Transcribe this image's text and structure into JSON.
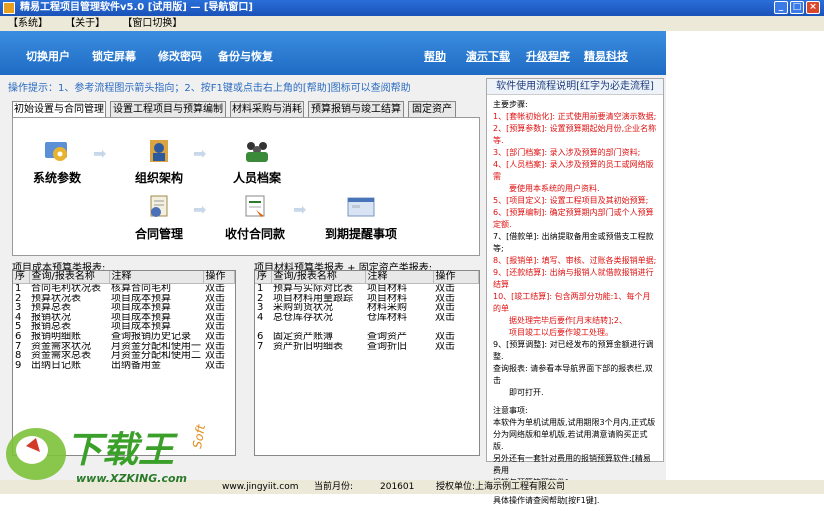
{
  "titlebar": {
    "title": "精易工程项目管理软件v5.0 [试用版] — [导航窗口]"
  },
  "window_buttons": {
    "minimize": "_",
    "maximize": "□",
    "close": "×"
  },
  "menu": [
    "【系统】",
    "【关于】",
    "【窗口切换】"
  ],
  "toolbar_left": [
    "切换用户",
    "锁定屏幕",
    "修改密码",
    "备份与恢复"
  ],
  "toolbar_right": [
    "帮助",
    "演示下载",
    "升级程序",
    "精易科技"
  ],
  "hint": "操作提示：1、参考流程图示箭头指向；2、按F1键或点击右上角的[帮助]图标可以查阅帮助",
  "tabs": [
    "初始设置与合同管理",
    "设置工程项目与预算编制",
    "材料采购与消耗",
    "预算报销与竣工结算",
    "固定资产"
  ],
  "flow": {
    "row1": [
      "系统参数",
      "组织架构",
      "人员档案"
    ],
    "row2": [
      "合同管理",
      "收付合同款",
      "到期提醒事项"
    ]
  },
  "left_grid": {
    "title": "项目成本预算类报表:",
    "headers": [
      "序",
      "查询/报表名称",
      "注释",
      "操作"
    ],
    "rows": [
      [
        "1",
        "合同毛利状况表",
        "核算合同毛利",
        "双击"
      ],
      [
        "2",
        "预算状况表",
        "项目成本预算",
        "双击"
      ],
      [
        "3",
        "预算总表",
        "项目成本预算",
        "双击"
      ],
      [
        "4",
        "报销状况",
        "项目成本预算",
        "双击"
      ],
      [
        "5",
        "报销总表",
        "项目成本预算",
        "双击"
      ],
      [
        "6",
        "报销明细账",
        "查询报销历史记录",
        "双击"
      ],
      [
        "7",
        "资金需求状况",
        "月资金分配和使用一",
        "双击"
      ],
      [
        "8",
        "资金需求总表",
        "月资金分配和使用二",
        "双击"
      ],
      [
        "9",
        "出纳日记账",
        "出纳备用金",
        "双击"
      ]
    ]
  },
  "right_grid": {
    "title": "项目材料预算类报表 + 固定资产类报表:",
    "headers": [
      "序",
      "查询/报表名称",
      "注释",
      "操作"
    ],
    "rows": [
      [
        "1",
        "预算与实际对比表",
        "项目材料",
        "双击"
      ],
      [
        "2",
        "项目材料用量跟踪",
        "项目材料",
        "双击"
      ],
      [
        "3",
        "采购到货状况",
        "材料采购",
        "双击"
      ],
      [
        "4",
        "总仓库存状况",
        "仓库材料",
        "双击"
      ],
      [
        "",
        "",
        "",
        ""
      ],
      [
        "6",
        "固定资产账簿",
        "查询资产",
        "双击"
      ],
      [
        "7",
        "资产折旧明细表",
        "查询折旧",
        "双击"
      ]
    ]
  },
  "help_panel": {
    "title": "软件使用流程说明[红字为必走流程]",
    "lines": [
      {
        "text": "主要步骤:",
        "red": false
      },
      {
        "text": "1、[套帐初始化]: 正式使用前要清空演示数据;",
        "red": true
      },
      {
        "text": "2、[预算参数]: 设置预算期起始月份,企业名称等.",
        "red": true
      },
      {
        "text": "3、[部门档案]: 录入涉及预算的部门资料;",
        "red": true
      },
      {
        "text": "4、[人员档案]: 录入涉及预算的员工或网络版需",
        "red": true
      },
      {
        "text": "　　要使用本系统的用户资料.",
        "red": true
      },
      {
        "text": "5、[项目定义]: 设置工程项目及其初始预算;",
        "red": true
      },
      {
        "text": "6、[预算编制]: 确定预算期内部门或个人预算定额.",
        "red": true
      },
      {
        "text": "7、[借款单]: 出纳提取备用金或预借支工程款等;",
        "red": false
      },
      {
        "text": "8、[报销单]: 填写、审核、过账各类报销单据;",
        "red": true
      },
      {
        "text": "9、[还款结算]: 出纳与报销人就借款报销进行结算",
        "red": true
      },
      {
        "text": "10、[竣工结算]: 包含两部分功能:1、每个月的单",
        "red": true
      },
      {
        "text": "　　据处理完毕后要作[月末结转];2、",
        "red": true
      },
      {
        "text": "　　项目竣工以后要作竣工处理。",
        "red": true
      },
      {
        "text": "9、[预算调整]: 对已经发布的预算金额进行调整.",
        "red": false
      },
      {
        "text": "查询报表: 请参看本导航界面下部的报表栏,双击",
        "red": false
      },
      {
        "text": "　　即可打开.",
        "red": false
      },
      {
        "text": "",
        "red": false
      },
      {
        "text": "注意事项:",
        "red": false
      },
      {
        "text": "本软件为单机试用版,试用期限3个月内,正式版",
        "red": false
      },
      {
        "text": "分为网络版和单机版,若试用满意请购买正式版.",
        "red": false
      },
      {
        "text": "另外还有一套针对费用的报销预算软件:[精易费用",
        "red": false
      },
      {
        "text": "报销与预算管理软件].",
        "red": false
      },
      {
        "text": "",
        "red": false
      },
      {
        "text": "具体操作请查阅帮助[按F1键].",
        "red": false
      }
    ]
  },
  "statusbar": {
    "site": "www.jingyiit.com",
    "period_label": "当前月份:",
    "period": "201601",
    "auth_label": "授权单位:上海示例工程有限公司"
  },
  "watermark": {
    "brand": "下载王",
    "url": "www.XZKING.com",
    "soft": "Soft"
  },
  "colors": {
    "toolbar": "#1f6bc4",
    "accent_red": "#e01010",
    "hint_blue": "#2a6bc0"
  }
}
